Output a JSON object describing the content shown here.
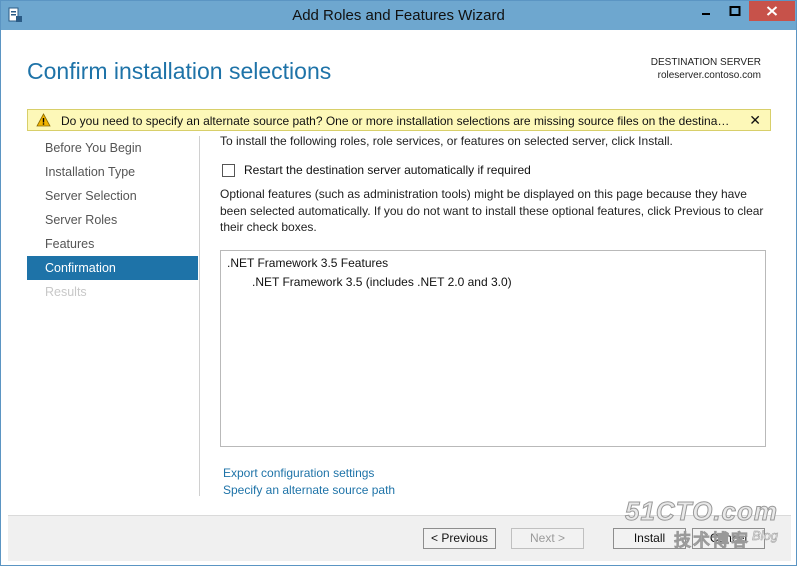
{
  "window": {
    "title": "Add Roles and Features Wizard"
  },
  "page": {
    "heading": "Confirm installation selections",
    "destination_label": "DESTINATION SERVER",
    "destination_server": "roleserver.contoso.com"
  },
  "warning": {
    "text": "Do you need to specify an alternate source path? One or more installation selections are missing source files on the destination server.",
    "close": "✕"
  },
  "nav": {
    "items": [
      {
        "label": "Before You Begin"
      },
      {
        "label": "Installation Type"
      },
      {
        "label": "Server Selection"
      },
      {
        "label": "Server Roles"
      },
      {
        "label": "Features"
      },
      {
        "label": "Confirmation"
      },
      {
        "label": "Results"
      }
    ]
  },
  "main": {
    "intro": "To install the following roles, role services, or features on selected server, click Install.",
    "restart_label": "Restart the destination server automatically if required",
    "optional_text": "Optional features (such as administration tools) might be displayed on this page because they have been selected automatically. If you do not want to install these optional features, click Previous to clear their check boxes.",
    "features": {
      "group": ".NET Framework 3.5 Features",
      "item": ".NET Framework 3.5 (includes .NET 2.0 and 3.0)"
    },
    "links": {
      "export": "Export configuration settings",
      "alternate_source": "Specify an alternate source path"
    }
  },
  "buttons": {
    "previous": "< Previous",
    "next": "Next >",
    "install": "Install",
    "cancel": "Cancel"
  },
  "watermark": {
    "main": "51CTO.com",
    "sub": "技术博客",
    "blog": "Blog"
  },
  "colors": {
    "titlebar": "#6ea7cf",
    "accent": "#1e73a8",
    "close_button": "#c7524a",
    "warning_bg": "#fdf8b8"
  }
}
